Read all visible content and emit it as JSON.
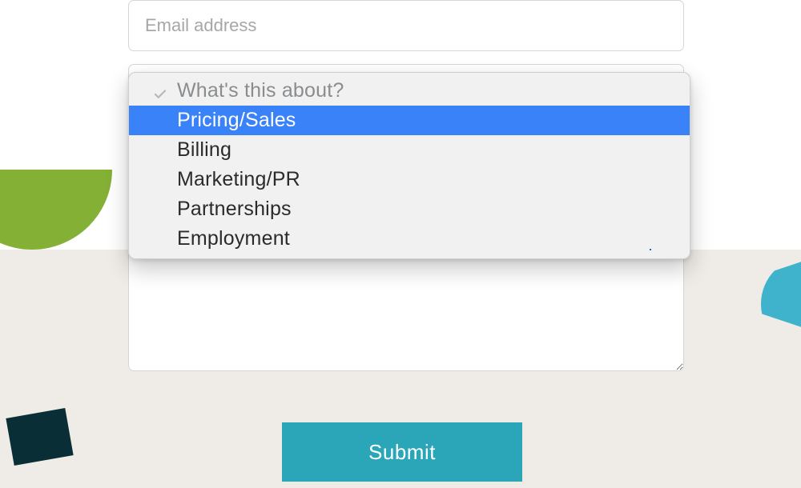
{
  "form": {
    "email_placeholder": "Email address",
    "email_value": "",
    "message_value": "",
    "submit_label": "Submit"
  },
  "topic_dropdown": {
    "placeholder": "What's this about?",
    "highlighted_index": 0,
    "options": [
      "Pricing/Sales",
      "Billing",
      "Marketing/PR",
      "Partnerships",
      "Employment"
    ]
  },
  "colors": {
    "accent_teal": "#2aa6b8",
    "highlight_blue": "#3a82f7",
    "deco_green": "#84b035",
    "beige": "#efebe6"
  }
}
